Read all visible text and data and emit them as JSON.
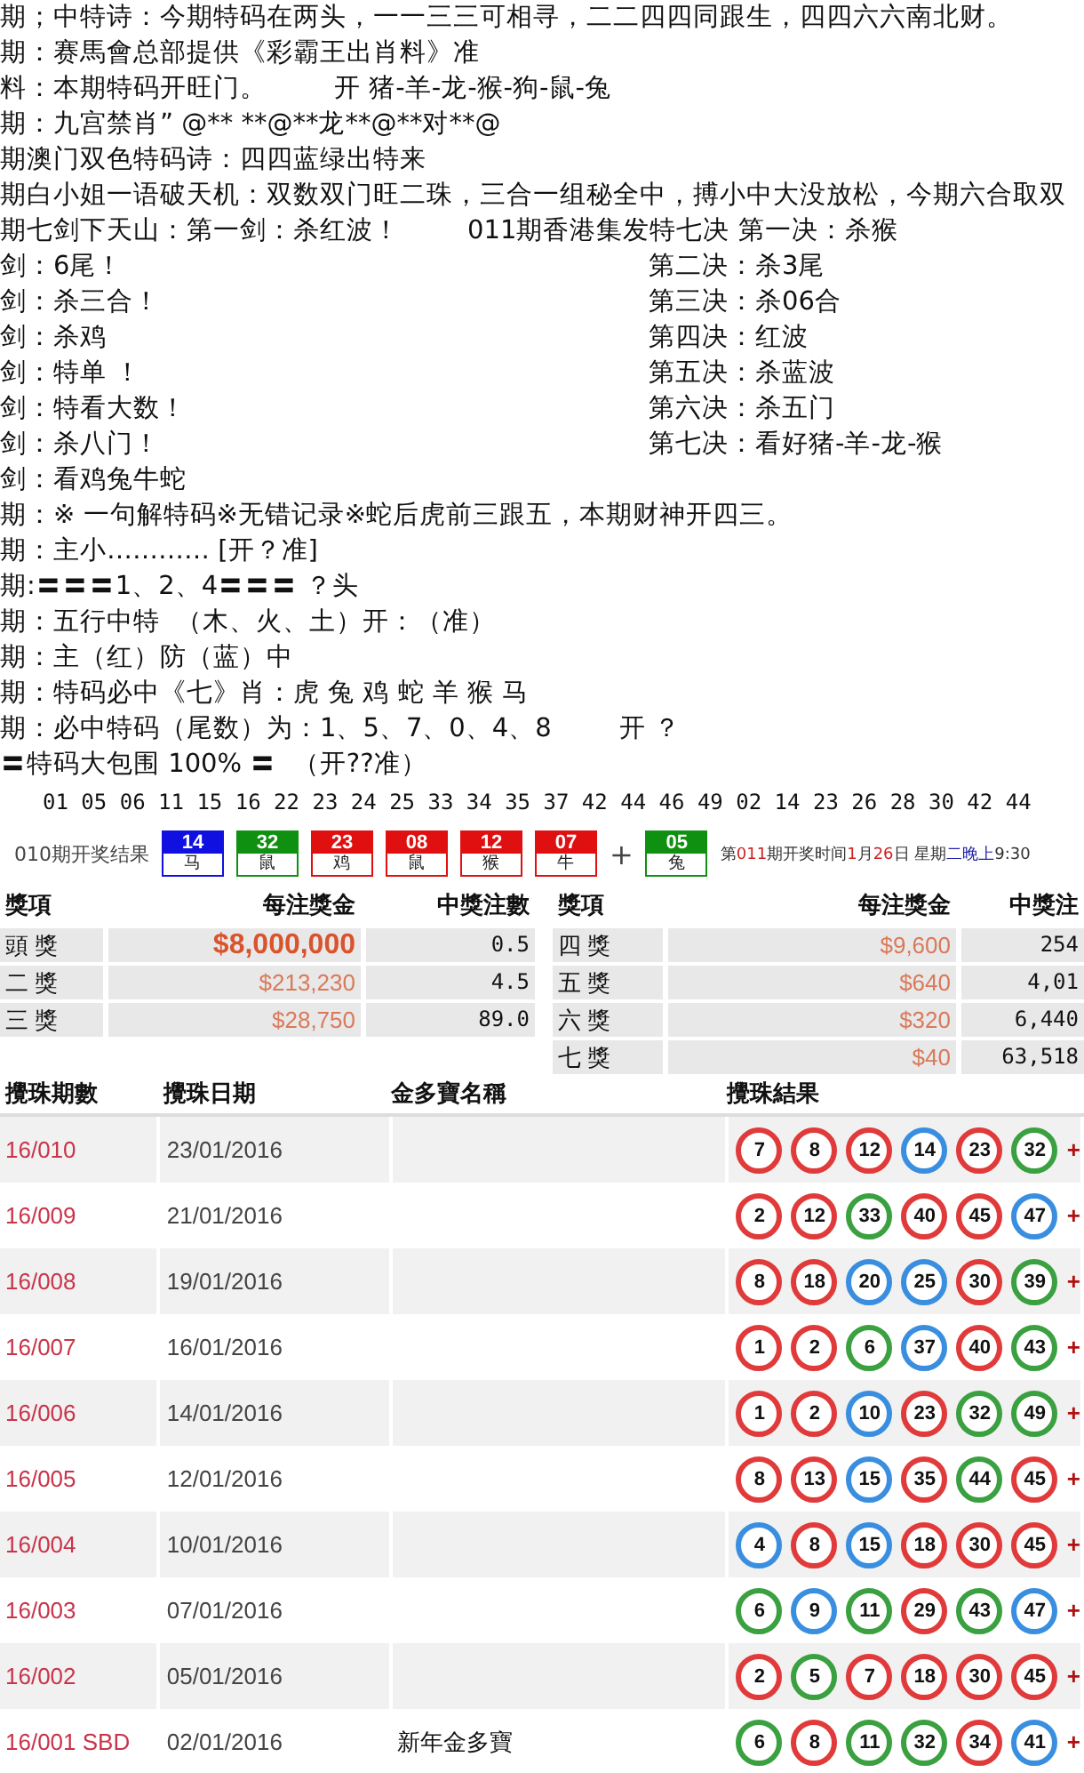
{
  "text_lines": [
    {
      "kind": "single",
      "text": "期；中特诗：今期特码在两头，一一三三可相寻，二二四四同跟生，四四六六南北财。"
    },
    {
      "kind": "single",
      "text": "期：赛馬會总部提供《彩霸王出肖料》准"
    },
    {
      "kind": "two",
      "left": "料：本期特码开旺门。",
      "right": "开 猪-羊-龙-猴-狗-鼠-兔"
    },
    {
      "kind": "single",
      "text": "期：九宫禁肖” @** **@**龙**@**对**@"
    },
    {
      "kind": "single",
      "text": "期澳门双色特码诗：四四蓝绿出特来"
    },
    {
      "kind": "single",
      "text": "期白小姐一语破天机：双数双门旺二珠，三合一组秘全中，搏小中大没放松，今期六合取双"
    },
    {
      "kind": "two",
      "left": "期七剑下天山：第一剑：杀红波！",
      "right": "011期香港集发特七决 第一决：杀猴"
    },
    {
      "kind": "columns",
      "left": "剑：6尾！",
      "right": "第二决：杀3尾"
    },
    {
      "kind": "columns",
      "left": "剑：杀三合！",
      "right": "第三决：杀06合"
    },
    {
      "kind": "columns",
      "left": "剑：杀鸡",
      "right": "第四决：红波"
    },
    {
      "kind": "columns",
      "left": "剑：特单 ！",
      "right": "第五决：杀蓝波"
    },
    {
      "kind": "columns",
      "left": "剑：特看大数！",
      "right": "第六决：杀五门"
    },
    {
      "kind": "columns",
      "left": "剑：杀八门！",
      "right": "第七决：看好猪-羊-龙-猴"
    },
    {
      "kind": "single",
      "text": "剑：看鸡兔牛蛇"
    },
    {
      "kind": "single",
      "text": "期：※ 一句解特码※无错记录※蛇后虎前三跟五，本期财神开四三。"
    },
    {
      "kind": "single",
      "text": "期：主小………… [开？准]"
    },
    {
      "kind": "single",
      "text": "期:〓〓〓1、2、4〓〓〓 ？头"
    },
    {
      "kind": "single",
      "text": "期：五行中特  （木、火、土）开：（准）"
    },
    {
      "kind": "single",
      "text": "期：主（红）防（蓝）中"
    },
    {
      "kind": "single",
      "text": "期：特码必中《七》肖：虎 兔 鸡 蛇 羊 猴 马"
    },
    {
      "kind": "two",
      "left": "期：必中特码（尾数）为：1、5、7、0、4、8",
      "right": "开 ？"
    },
    {
      "kind": "single",
      "text": "〓特码大包围 100% 〓  （开??准）"
    }
  ],
  "number_line": "01 05 06 11 15 16 22 23 24 25 33 34 35 37 42 44 46 49 02 14 23 26 28 30 42 44",
  "draw_result": {
    "label": "010期开奖结果",
    "balls": [
      {
        "number": "14",
        "zodiac": "马",
        "color": "#1010e0"
      },
      {
        "number": "32",
        "zodiac": "鼠",
        "color": "#109010"
      },
      {
        "number": "23",
        "zodiac": "鸡",
        "color": "#e01010"
      },
      {
        "number": "08",
        "zodiac": "鼠",
        "color": "#e01010"
      },
      {
        "number": "12",
        "zodiac": "猴",
        "color": "#e01010"
      },
      {
        "number": "07",
        "zodiac": "牛",
        "color": "#e01010"
      }
    ],
    "plus": "+",
    "special": {
      "number": "05",
      "zodiac": "兔",
      "color": "#109010"
    },
    "next_draw": [
      {
        "text": "第",
        "color": "#333333"
      },
      {
        "text": "011",
        "color": "#cc2222"
      },
      {
        "text": "期开奖时间",
        "color": "#333333"
      },
      {
        "text": "1",
        "color": "#cc2222"
      },
      {
        "text": "月",
        "color": "#333333"
      },
      {
        "text": "26",
        "color": "#cc2222"
      },
      {
        "text": "日 星期",
        "color": "#333333"
      },
      {
        "text": "二晚上",
        "color": "#2222aa"
      },
      {
        "text": "9:30",
        "color": "#333333"
      }
    ]
  },
  "prizes": [
    {
      "columns": [
        "獎項",
        "每注獎金",
        "中獎注數"
      ],
      "rows": [
        {
          "name": "頭 獎",
          "amount": "$8,000,000",
          "count": "0.5",
          "featured": true
        },
        {
          "name": "二 獎",
          "amount": "$213,230",
          "count": "4.5",
          "featured": false
        },
        {
          "name": "三 獎",
          "amount": "$28,750",
          "count": "89.0",
          "featured": false
        }
      ]
    },
    {
      "columns": [
        "獎項",
        "每注獎金",
        "中獎注"
      ],
      "rows": [
        {
          "name": "四 獎",
          "amount": "$9,600",
          "count": "254",
          "featured": false
        },
        {
          "name": "五 獎",
          "amount": "$640",
          "count": "4,01",
          "featured": false
        },
        {
          "name": "六 獎",
          "amount": "$320",
          "count": "6,440",
          "featured": false
        },
        {
          "name": "七 獎",
          "amount": "$40",
          "count": "63,518",
          "featured": false
        }
      ]
    }
  ],
  "results": {
    "columns": [
      "攪珠期數",
      "攪珠日期",
      "金多寶名稱",
      "攪珠結果"
    ],
    "rows": [
      {
        "period": "16/010",
        "date": "23/01/2016",
        "balls": [
          {
            "number": "7",
            "color": "#e03a3a"
          },
          {
            "number": "8",
            "color": "#e03a3a"
          },
          {
            "number": "12",
            "color": "#e03a3a"
          },
          {
            "number": "14",
            "color": "#3a8ee0"
          },
          {
            "number": "23",
            "color": "#e03a3a"
          },
          {
            "number": "32",
            "color": "#3aa040"
          }
        ],
        "plus": "+"
      },
      {
        "period": "16/009",
        "date": "21/01/2016",
        "balls": [
          {
            "number": "2",
            "color": "#e03a3a"
          },
          {
            "number": "12",
            "color": "#e03a3a"
          },
          {
            "number": "33",
            "color": "#3aa040"
          },
          {
            "number": "40",
            "color": "#e03a3a"
          },
          {
            "number": "45",
            "color": "#e03a3a"
          },
          {
            "number": "47",
            "color": "#3a8ee0"
          }
        ],
        "plus": "+"
      },
      {
        "period": "16/008",
        "date": "19/01/2016",
        "balls": [
          {
            "number": "8",
            "color": "#e03a3a"
          },
          {
            "number": "18",
            "color": "#e03a3a"
          },
          {
            "number": "20",
            "color": "#3a8ee0"
          },
          {
            "number": "25",
            "color": "#3a8ee0"
          },
          {
            "number": "30",
            "color": "#e03a3a"
          },
          {
            "number": "39",
            "color": "#3aa040"
          }
        ],
        "plus": "+"
      },
      {
        "period": "16/007",
        "date": "16/01/2016",
        "balls": [
          {
            "number": "1",
            "color": "#e03a3a"
          },
          {
            "number": "2",
            "color": "#e03a3a"
          },
          {
            "number": "6",
            "color": "#3aa040"
          },
          {
            "number": "37",
            "color": "#3a8ee0"
          },
          {
            "number": "40",
            "color": "#e03a3a"
          },
          {
            "number": "43",
            "color": "#3aa040"
          }
        ],
        "plus": "+"
      },
      {
        "period": "16/006",
        "date": "14/01/2016",
        "balls": [
          {
            "number": "1",
            "color": "#e03a3a"
          },
          {
            "number": "2",
            "color": "#e03a3a"
          },
          {
            "number": "10",
            "color": "#3a8ee0"
          },
          {
            "number": "23",
            "color": "#e03a3a"
          },
          {
            "number": "32",
            "color": "#3aa040"
          },
          {
            "number": "49",
            "color": "#3aa040"
          }
        ],
        "plus": "+"
      },
      {
        "period": "16/005",
        "date": "12/01/2016",
        "balls": [
          {
            "number": "8",
            "color": "#e03a3a"
          },
          {
            "number": "13",
            "color": "#e03a3a"
          },
          {
            "number": "15",
            "color": "#3a8ee0"
          },
          {
            "number": "35",
            "color": "#e03a3a"
          },
          {
            "number": "44",
            "color": "#3aa040"
          },
          {
            "number": "45",
            "color": "#e03a3a"
          }
        ],
        "plus": "+"
      },
      {
        "period": "16/004",
        "date": "10/01/2016",
        "balls": [
          {
            "number": "4",
            "color": "#3a8ee0"
          },
          {
            "number": "8",
            "color": "#e03a3a"
          },
          {
            "number": "15",
            "color": "#3a8ee0"
          },
          {
            "number": "18",
            "color": "#e03a3a"
          },
          {
            "number": "30",
            "color": "#e03a3a"
          },
          {
            "number": "45",
            "color": "#e03a3a"
          }
        ],
        "plus": "+"
      },
      {
        "period": "16/003",
        "date": "07/01/2016",
        "balls": [
          {
            "number": "6",
            "color": "#3aa040"
          },
          {
            "number": "9",
            "color": "#3a8ee0"
          },
          {
            "number": "11",
            "color": "#3aa040"
          },
          {
            "number": "29",
            "color": "#e03a3a"
          },
          {
            "number": "43",
            "color": "#3aa040"
          },
          {
            "number": "47",
            "color": "#3a8ee0"
          }
        ],
        "plus": "+"
      },
      {
        "period": "16/002",
        "date": "05/01/2016",
        "balls": [
          {
            "number": "2",
            "color": "#e03a3a"
          },
          {
            "number": "5",
            "color": "#3aa040"
          },
          {
            "number": "7",
            "color": "#e03a3a"
          },
          {
            "number": "18",
            "color": "#e03a3a"
          },
          {
            "number": "30",
            "color": "#e03a3a"
          },
          {
            "number": "45",
            "color": "#e03a3a"
          }
        ],
        "plus": "+"
      },
      {
        "period": "16/001 SBD",
        "date": "02/01/2016",
        "name": "新年金多寶",
        "balls": [
          {
            "number": "6",
            "color": "#3aa040"
          },
          {
            "number": "8",
            "color": "#e03a3a"
          },
          {
            "number": "11",
            "color": "#3aa040"
          },
          {
            "number": "32",
            "color": "#3aa040"
          },
          {
            "number": "34",
            "color": "#e03a3a"
          },
          {
            "number": "41",
            "color": "#3a8ee0"
          }
        ],
        "plus": "+"
      }
    ]
  }
}
